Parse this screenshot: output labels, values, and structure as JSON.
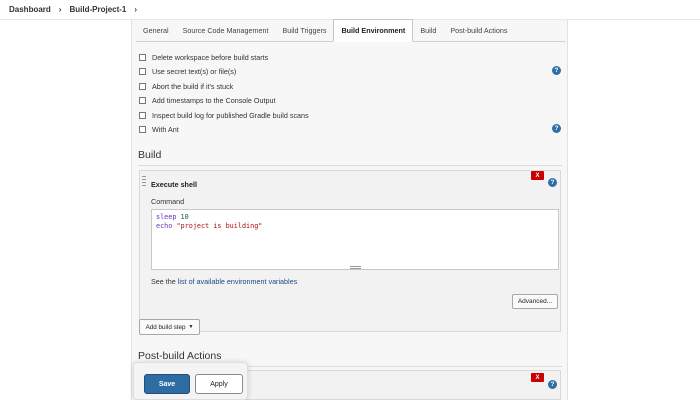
{
  "breadcrumb": {
    "items": [
      "Dashboard",
      "Build-Project-1"
    ],
    "separator": "›"
  },
  "tabs": [
    {
      "label": "General",
      "active": false
    },
    {
      "label": "Source Code Management",
      "active": false
    },
    {
      "label": "Build Triggers",
      "active": false
    },
    {
      "label": "Build Environment",
      "active": true
    },
    {
      "label": "Build",
      "active": false
    },
    {
      "label": "Post-build Actions",
      "active": false
    }
  ],
  "build_environment": {
    "options": [
      {
        "label": "Delete workspace before build starts",
        "checked": false
      },
      {
        "label": "Use secret text(s) or file(s)",
        "checked": false
      },
      {
        "label": "Abort the build if it's stuck",
        "checked": false
      },
      {
        "label": "Add timestamps to the Console Output",
        "checked": false
      },
      {
        "label": "Inspect build log for published Gradle build scans",
        "checked": false
      },
      {
        "label": "With Ant",
        "checked": false
      }
    ]
  },
  "build": {
    "title": "Build",
    "step_title": "Execute shell",
    "delete_label": "X",
    "command_label": "Command",
    "command_lines": [
      "sleep 10",
      "echo \"project is building\""
    ],
    "env_text": "See the ",
    "env_link": "list of available environment variables",
    "advanced_label": "Advanced...",
    "add_step_label": "Add build step",
    "add_step_caret": "▼"
  },
  "post_build": {
    "title": "Post-build Actions",
    "delete_label": "X"
  },
  "help_label": "?",
  "actions": {
    "save_label": "Save",
    "apply_label": "Apply"
  },
  "colors": {
    "accent": "#2f6ca3",
    "danger": "#cc0000",
    "link": "#204a87"
  }
}
